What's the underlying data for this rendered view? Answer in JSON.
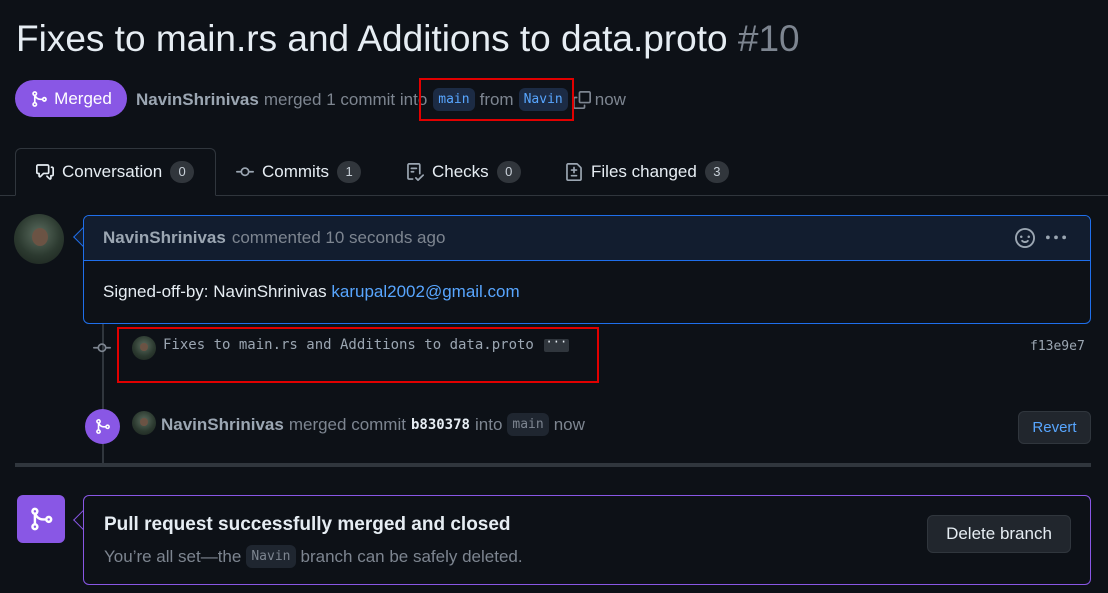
{
  "pr": {
    "title": "Fixes to main.rs and Additions to data.proto",
    "number": "#10",
    "status_label": "Merged",
    "author": "NavinShrinivas",
    "merge_text": "merged 1 commit into",
    "base_branch": "main",
    "from_text": "from",
    "head_branch": "Navin",
    "time": "now"
  },
  "tabs": [
    {
      "label": "Conversation",
      "count": "0",
      "icon": "comment-discussion-icon"
    },
    {
      "label": "Commits",
      "count": "1",
      "icon": "git-commit-icon"
    },
    {
      "label": "Checks",
      "count": "0",
      "icon": "checklist-icon"
    },
    {
      "label": "Files changed",
      "count": "3",
      "icon": "file-diff-icon"
    }
  ],
  "comment": {
    "author": "NavinShrinivas",
    "action": "commented 10 seconds ago",
    "body_prefix": "Signed-off-by: NavinShrinivas",
    "email": "karupal2002@gmail.com"
  },
  "commit": {
    "message": "Fixes to main.rs and Additions to data.proto",
    "ellipsis": "···",
    "sha": "f13e9e7"
  },
  "merge_event": {
    "author": "NavinShrinivas",
    "text1": "merged commit",
    "sha": "b830378",
    "text2": "into",
    "branch": "main",
    "time": "now",
    "revert_label": "Revert"
  },
  "merged_box": {
    "title": "Pull request successfully merged and closed",
    "desc_prefix": "You’re all set—the",
    "branch": "Navin",
    "desc_suffix": "branch can be safely deleted.",
    "delete_label": "Delete branch"
  },
  "colors": {
    "merged_purple": "#8957e5",
    "link_blue": "#58a6ff",
    "highlight_red": "#e10000",
    "background": "#0d1117"
  }
}
